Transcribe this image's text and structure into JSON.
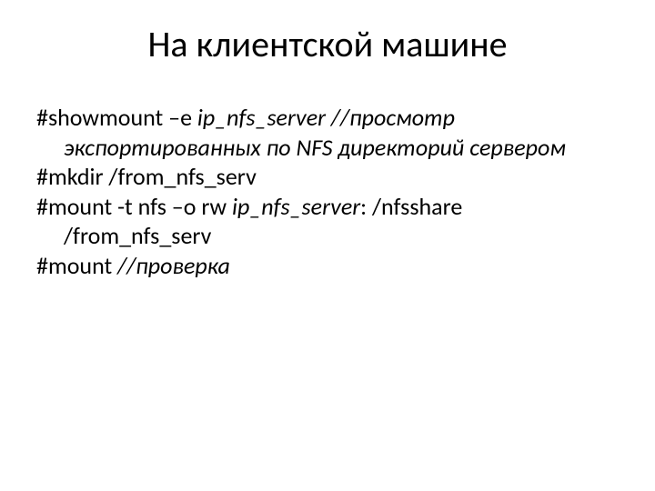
{
  "title": "На клиентской машине",
  "lines": {
    "l1a": "#showmount  –e  ",
    "l1b": "ip_nfs_server //просмотр",
    "l2": "экспортированных по NFS директорий сервером",
    "l3": "#mkdir /from_nfs_serv",
    "l4a": "#mount -t nfs  –o  rw ",
    "l4b": "ip_nfs_server",
    "l4c": ": /nfsshare",
    "l5": "/from_nfs_serv",
    "l6a": "#mount ",
    "l6b": "//проверка"
  }
}
